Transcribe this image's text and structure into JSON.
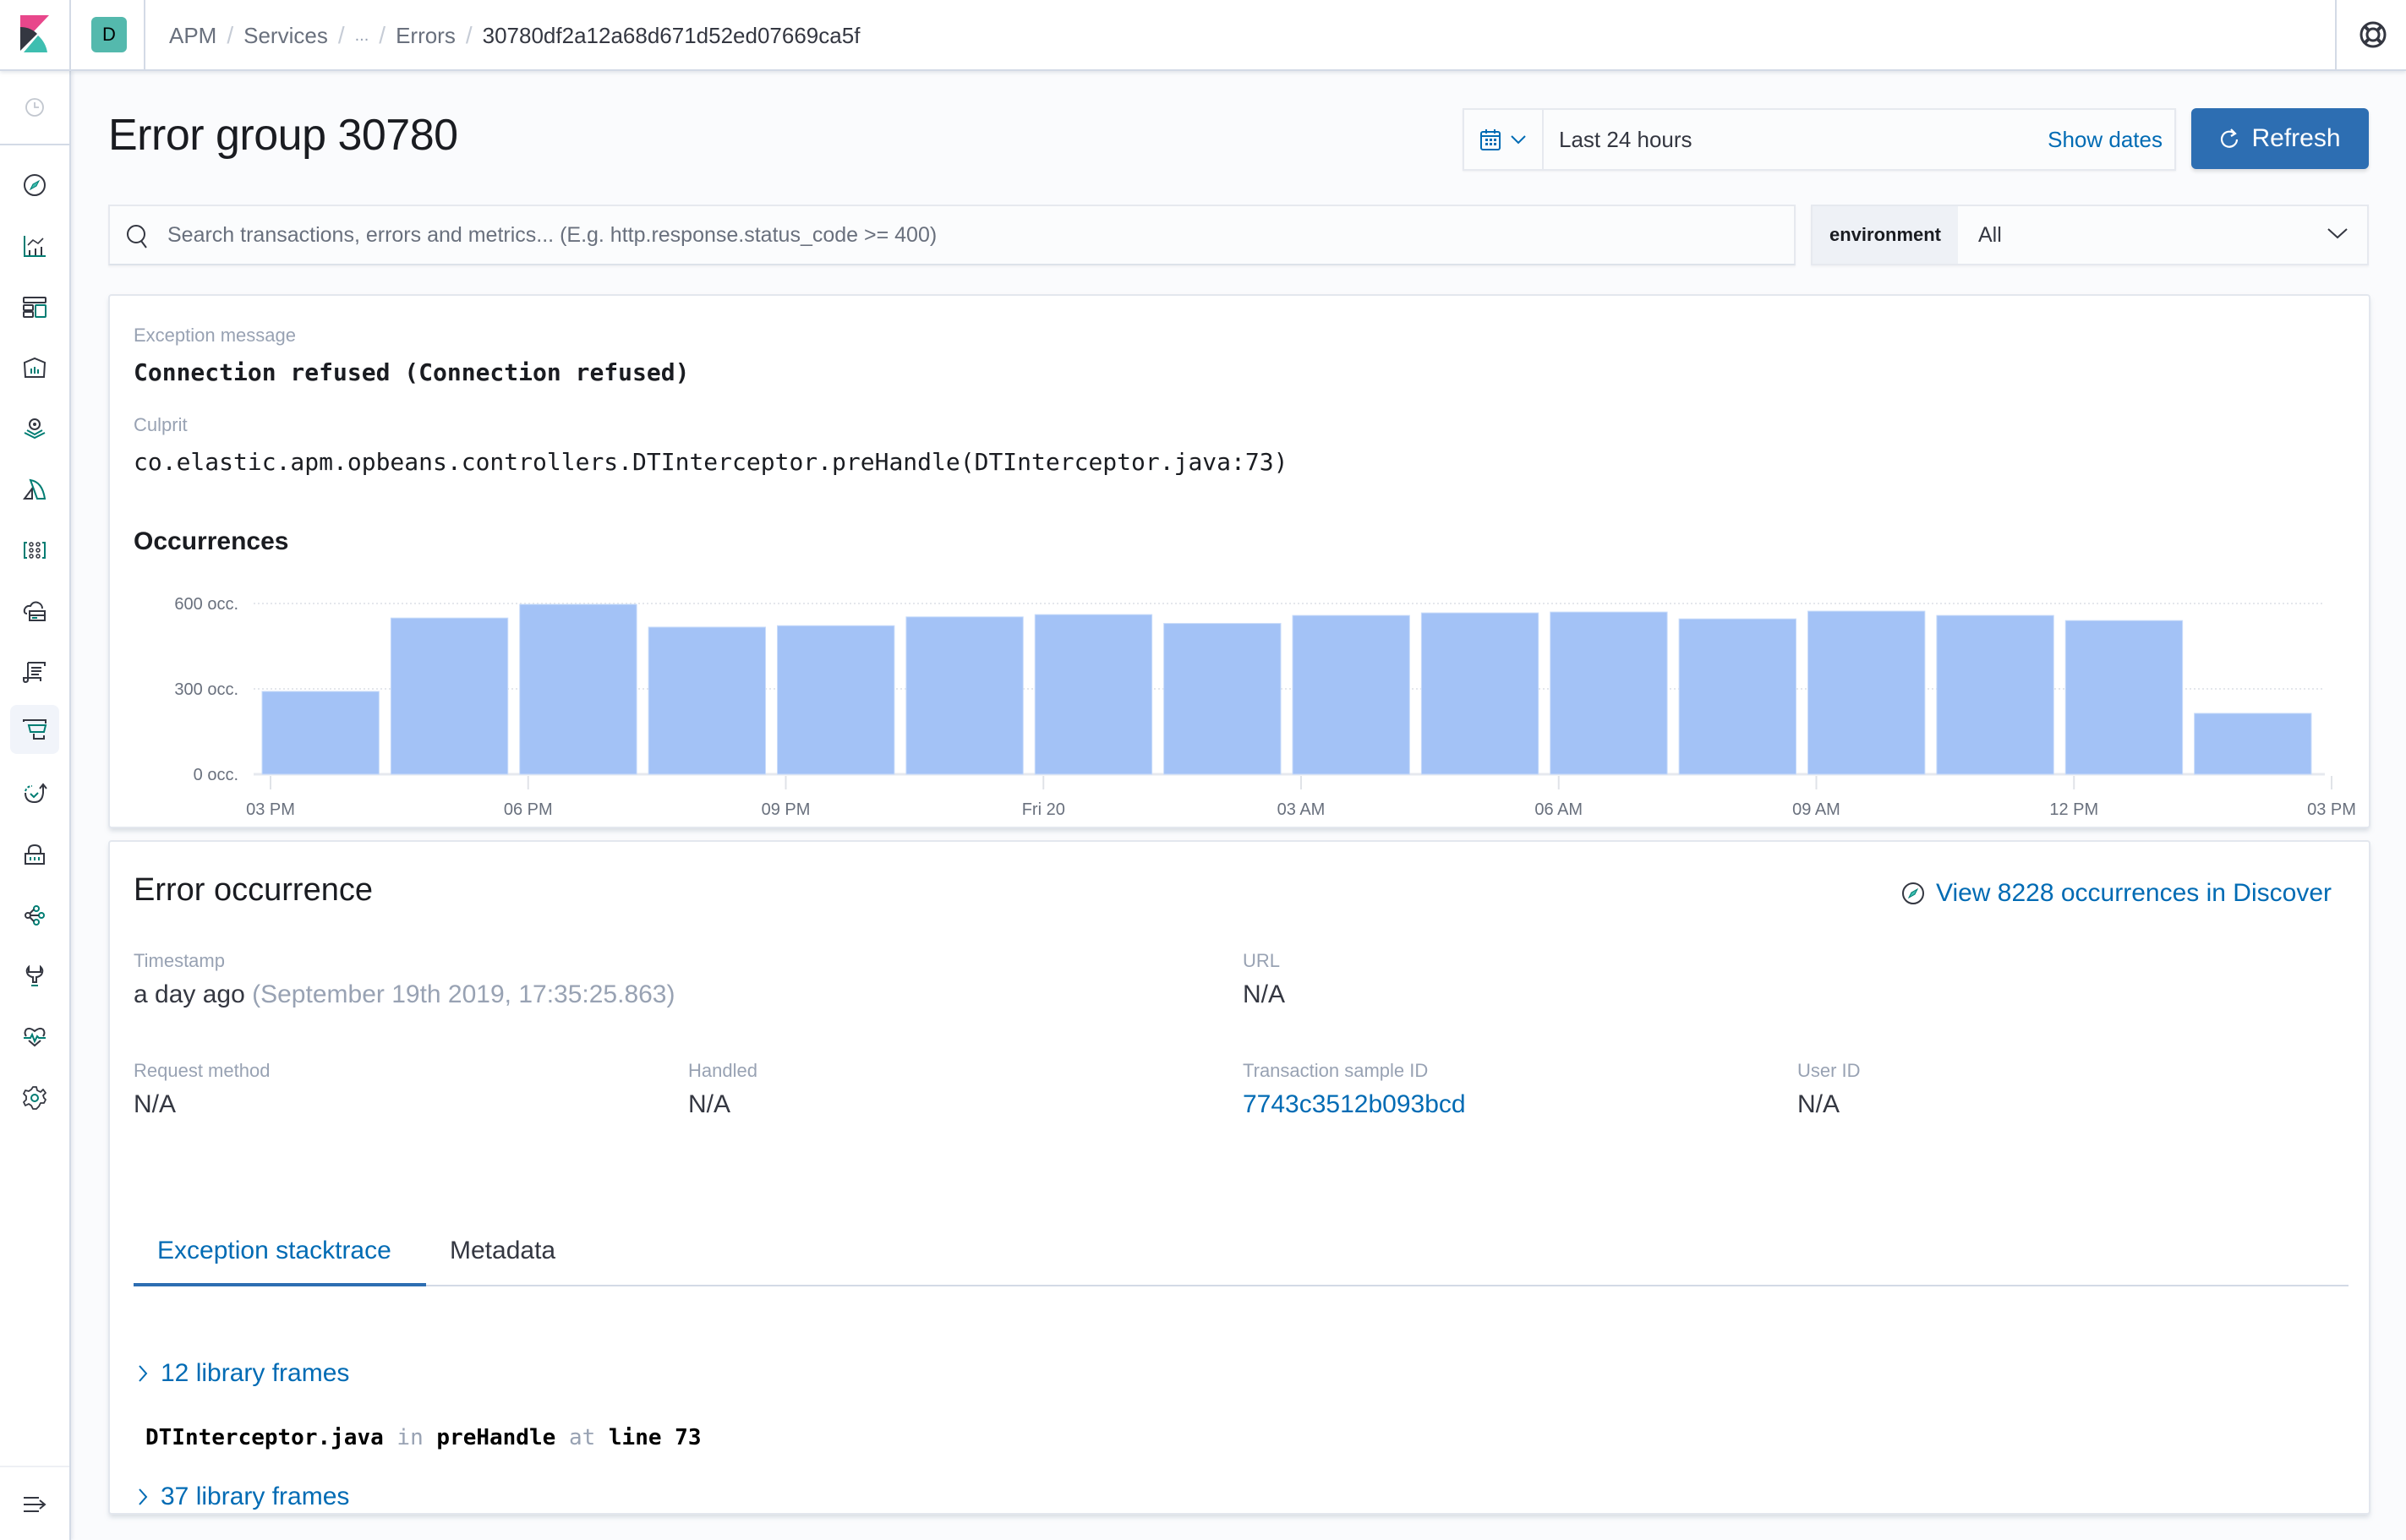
{
  "header": {
    "space_initial": "D",
    "breadcrumbs": [
      {
        "label": "APM"
      },
      {
        "label": "Services"
      },
      {
        "label": "..."
      },
      {
        "label": "Errors"
      },
      {
        "label": "30780df2a12a68d671d52ed07669ca5f"
      }
    ],
    "help_icon": "help-lifebuoy-icon"
  },
  "sidenav": {
    "items": [
      {
        "name": "recently-viewed",
        "icon": "clock-icon"
      },
      {
        "name": "discover",
        "icon": "compass-icon"
      },
      {
        "name": "visualize",
        "icon": "visualize-icon"
      },
      {
        "name": "dashboard",
        "icon": "dashboard-icon"
      },
      {
        "name": "canvas",
        "icon": "canvas-icon"
      },
      {
        "name": "maps",
        "icon": "maps-icon"
      },
      {
        "name": "machine-learning",
        "icon": "ml-icon"
      },
      {
        "name": "infrastructure",
        "icon": "infrastructure-icon"
      },
      {
        "name": "metrics",
        "icon": "metrics-icon"
      },
      {
        "name": "logs",
        "icon": "logs-icon"
      },
      {
        "name": "apm",
        "icon": "apm-icon",
        "active": true
      },
      {
        "name": "uptime",
        "icon": "uptime-icon"
      },
      {
        "name": "siem",
        "icon": "siem-icon"
      },
      {
        "name": "graph",
        "icon": "graph-icon"
      },
      {
        "name": "dev-tools",
        "icon": "wrench-icon"
      },
      {
        "name": "monitoring",
        "icon": "monitoring-icon"
      },
      {
        "name": "management",
        "icon": "gear-icon"
      }
    ],
    "collapse_icon": "menu-collapse-icon"
  },
  "page": {
    "title": "Error group 30780"
  },
  "datepicker": {
    "range_label": "Last 24 hours",
    "show_dates_label": "Show dates",
    "refresh_label": "Refresh"
  },
  "search": {
    "placeholder": "Search transactions, errors and metrics... (E.g. http.response.status_code >= 400)",
    "value": ""
  },
  "environment": {
    "label": "environment",
    "selected": "All"
  },
  "summary": {
    "exception_label": "Exception message",
    "exception_message": "Connection refused (Connection refused)",
    "culprit_label": "Culprit",
    "culprit": "co.elastic.apm.opbeans.controllers.DTInterceptor.preHandle(DTInterceptor.java:73)",
    "occurrences_title": "Occurrences"
  },
  "chart_data": {
    "type": "bar",
    "title": "Occurrences",
    "xlabel": "",
    "ylabel": "",
    "ylim": [
      0,
      600
    ],
    "y_ticks": [
      {
        "value": 0,
        "label": "0 occ."
      },
      {
        "value": 300,
        "label": "300 occ."
      },
      {
        "value": 600,
        "label": "600 occ."
      }
    ],
    "x_ticks": [
      "03 PM",
      "06 PM",
      "09 PM",
      "Fri 20",
      "03 AM",
      "06 AM",
      "09 AM",
      "12 PM",
      "03 PM"
    ],
    "bucket_hours": 1.5,
    "values": [
      291,
      549,
      597,
      517,
      522,
      553,
      561,
      530,
      558,
      567,
      570,
      546,
      573,
      558,
      540,
      214
    ],
    "bar_color": "#a3c2f6",
    "grid": true
  },
  "occurrence": {
    "title": "Error occurrence",
    "discover_link": "View 8228 occurrences in Discover",
    "timestamp_label": "Timestamp",
    "timestamp_relative": "a day ago",
    "timestamp_absolute": "(September 19th 2019, 17:35:25.863)",
    "url_label": "URL",
    "url_value": "N/A",
    "request_method_label": "Request method",
    "request_method_value": "N/A",
    "handled_label": "Handled",
    "handled_value": "N/A",
    "transaction_id_label": "Transaction sample ID",
    "transaction_id_value": "7743c3512b093bcd",
    "user_id_label": "User ID",
    "user_id_value": "N/A"
  },
  "tabs": [
    {
      "label": "Exception stacktrace",
      "active": true
    },
    {
      "label": "Metadata",
      "active": false
    }
  ],
  "stacktrace": {
    "library_frames_before": "12 library frames",
    "frame_file": "DTInterceptor.java",
    "frame_in": "in",
    "frame_function": "preHandle",
    "frame_at": "at",
    "frame_line": "line 73",
    "library_frames_after": "37 library frames"
  },
  "colors": {
    "accent": "#006bb4",
    "primary_button": "#2d6eb2",
    "bar": "#a3c2f6",
    "space_avatar": "#54b9ad"
  }
}
